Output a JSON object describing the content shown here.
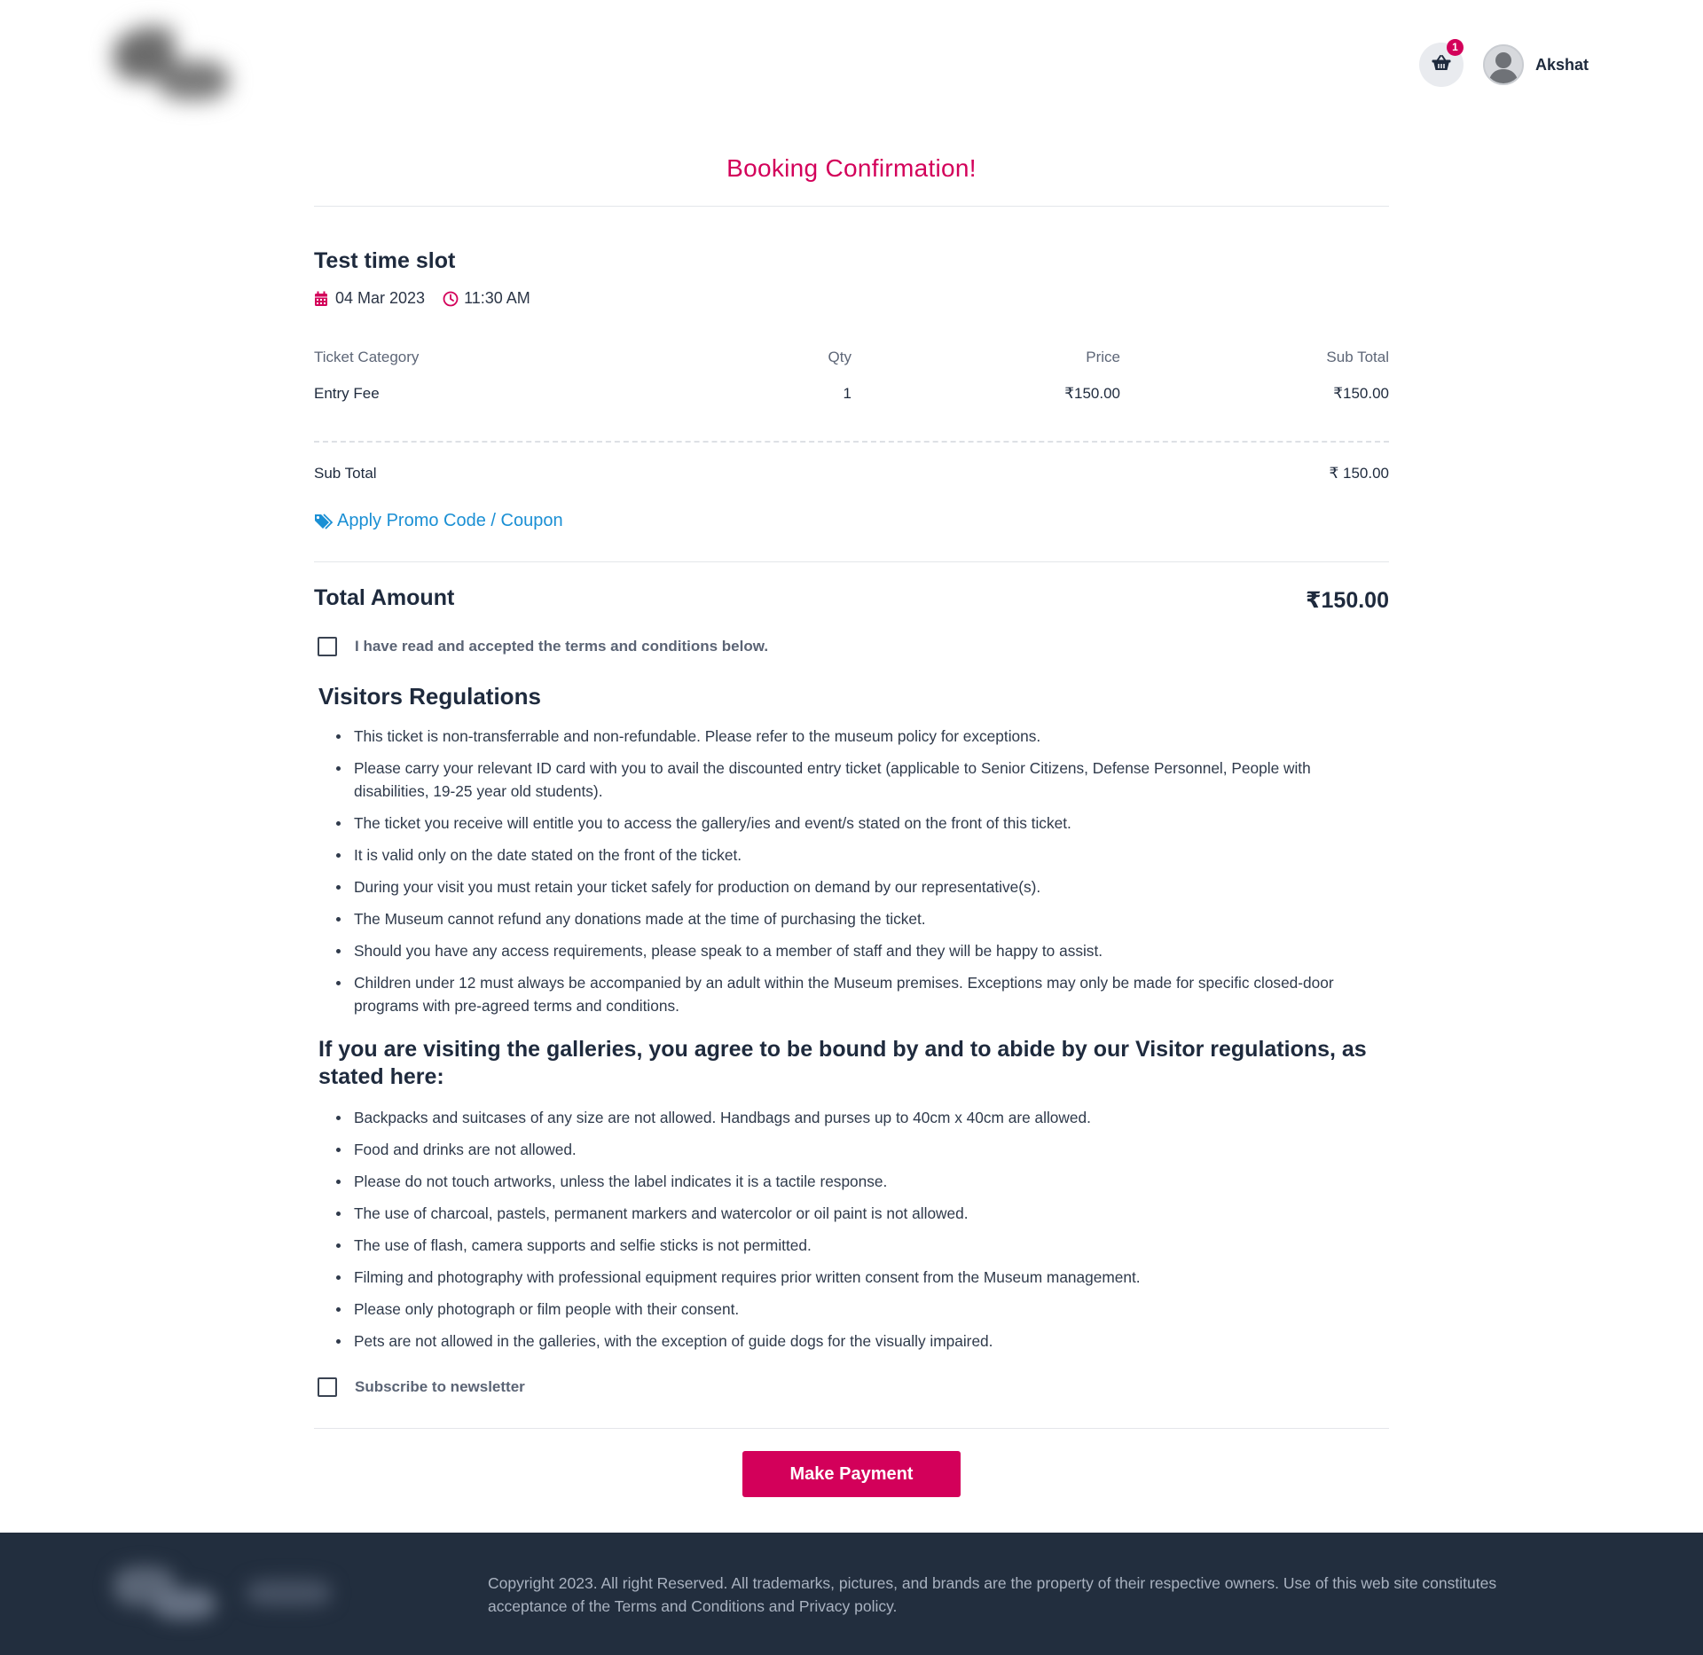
{
  "header": {
    "cart_count": "1",
    "username": "Akshat"
  },
  "page": {
    "title": "Booking Confirmation!"
  },
  "event": {
    "name": "Test time slot",
    "date": "04 Mar 2023",
    "time": "11:30 AM"
  },
  "table": {
    "headers": [
      "Ticket Category",
      "Qty",
      "Price",
      "Sub Total"
    ],
    "rows": [
      {
        "category": "Entry Fee",
        "qty": "1",
        "price": "₹150.00",
        "subtotal": "₹150.00"
      }
    ]
  },
  "summary": {
    "subtotal_label": "Sub Total",
    "subtotal_value": "₹ 150.00",
    "promo_label": "Apply Promo Code / Coupon",
    "total_label": "Total Amount",
    "total_value": "₹150.00"
  },
  "terms_checkbox": {
    "label": "I have read and accepted the terms and conditions below.",
    "checked": false
  },
  "regulations": {
    "heading": "Visitors Regulations",
    "items": [
      "This ticket is non-transferrable and non-refundable. Please refer to the museum policy for exceptions.",
      "Please carry your relevant ID card with you to avail the discounted entry ticket (applicable to Senior Citizens, Defense Personnel, People with disabilities, 19-25 year old students).",
      "The ticket you receive will entitle you to access the gallery/ies and event/s stated on the front of this ticket.",
      "It is valid only on the date stated on the front of the ticket.",
      "During your visit you must retain your ticket safely for production on demand by our representative(s).",
      "The Museum cannot refund any donations made at the time of purchasing the ticket.",
      "Should you have any access requirements, please speak to a member of staff and they will be happy to assist.",
      "Children under 12 must always be accompanied by an adult within the Museum premises. Exceptions may only be made for specific closed-door programs with pre-agreed terms and conditions."
    ]
  },
  "gallery_rules": {
    "heading": "If you are visiting the galleries, you agree to be bound by and to abide by our Visitor regulations, as stated here:",
    "items": [
      "Backpacks and suitcases of any size are not allowed. Handbags and purses up to 40cm x 40cm are allowed.",
      "Food and drinks are not allowed.",
      "Please do not touch artworks, unless the label indicates it is a tactile response.",
      "The use of charcoal, pastels, permanent markers and watercolor or oil paint is not allowed.",
      "The use of flash, camera supports and selfie sticks is not permitted.",
      "Filming and photography with professional equipment requires prior written consent from the Museum management.",
      "Please only photograph or film people with their consent.",
      "Pets are not allowed in the galleries, with the exception of guide dogs for the visually impaired."
    ]
  },
  "newsletter_checkbox": {
    "label": "Subscribe to newsletter",
    "checked": false
  },
  "actions": {
    "pay_label": "Make Payment"
  },
  "footer": {
    "copyright": "Copyright 2023. All right Reserved. All trademarks, pictures, and brands are the property of their respective owners. Use of this web site constitutes acceptance of the Terms and Conditions and Privacy policy."
  },
  "colors": {
    "brand": "#d3005a",
    "link": "#1a8fd4",
    "text": "#1e2a3d",
    "footer_bg": "#222e3e"
  },
  "icons": [
    "basket-icon",
    "calendar-icon",
    "clock-icon",
    "tag-icon",
    "user-avatar-icon"
  ]
}
